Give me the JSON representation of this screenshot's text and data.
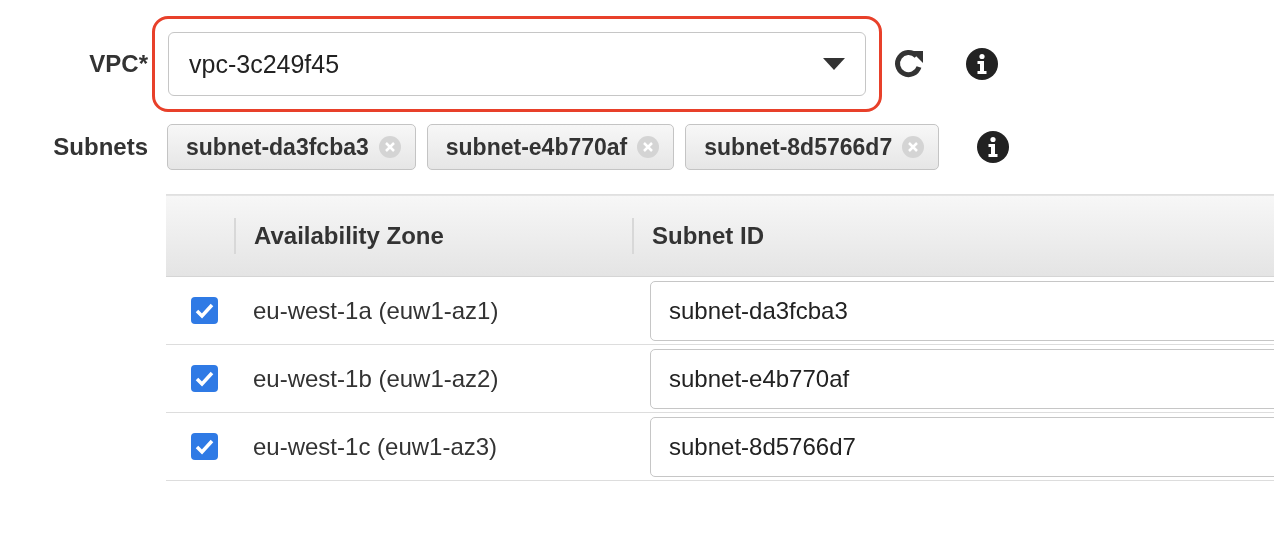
{
  "vpc": {
    "label": "VPC*",
    "value": "vpc-3c249f45",
    "highlighted": true
  },
  "subnets": {
    "label": "Subnets",
    "tokens": [
      "subnet-da3fcba3",
      "subnet-e4b770af",
      "subnet-8d5766d7"
    ]
  },
  "table": {
    "columns": [
      "Availability Zone",
      "Subnet ID"
    ],
    "rows": [
      {
        "checked": true,
        "zone": "eu-west-1a (euw1-az1)",
        "subnet_id": "subnet-da3fcba3"
      },
      {
        "checked": true,
        "zone": "eu-west-1b (euw1-az2)",
        "subnet_id": "subnet-e4b770af"
      },
      {
        "checked": true,
        "zone": "eu-west-1c (euw1-az3)",
        "subnet_id": "subnet-8d5766d7"
      }
    ]
  }
}
